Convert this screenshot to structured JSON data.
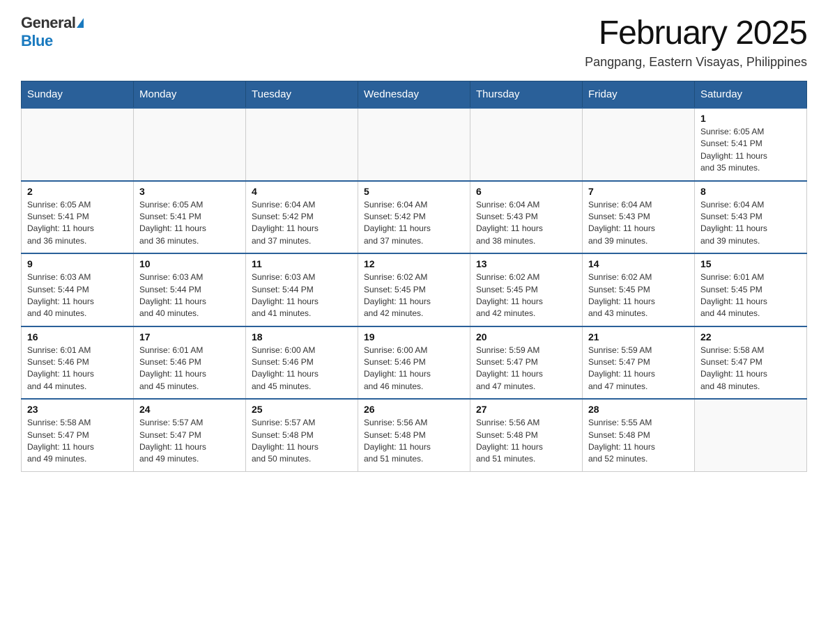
{
  "header": {
    "logo_general": "General",
    "logo_blue": "Blue",
    "month_title": "February 2025",
    "location": "Pangpang, Eastern Visayas, Philippines"
  },
  "weekdays": [
    "Sunday",
    "Monday",
    "Tuesday",
    "Wednesday",
    "Thursday",
    "Friday",
    "Saturday"
  ],
  "weeks": [
    [
      {
        "day": "",
        "info": ""
      },
      {
        "day": "",
        "info": ""
      },
      {
        "day": "",
        "info": ""
      },
      {
        "day": "",
        "info": ""
      },
      {
        "day": "",
        "info": ""
      },
      {
        "day": "",
        "info": ""
      },
      {
        "day": "1",
        "info": "Sunrise: 6:05 AM\nSunset: 5:41 PM\nDaylight: 11 hours\nand 35 minutes."
      }
    ],
    [
      {
        "day": "2",
        "info": "Sunrise: 6:05 AM\nSunset: 5:41 PM\nDaylight: 11 hours\nand 36 minutes."
      },
      {
        "day": "3",
        "info": "Sunrise: 6:05 AM\nSunset: 5:41 PM\nDaylight: 11 hours\nand 36 minutes."
      },
      {
        "day": "4",
        "info": "Sunrise: 6:04 AM\nSunset: 5:42 PM\nDaylight: 11 hours\nand 37 minutes."
      },
      {
        "day": "5",
        "info": "Sunrise: 6:04 AM\nSunset: 5:42 PM\nDaylight: 11 hours\nand 37 minutes."
      },
      {
        "day": "6",
        "info": "Sunrise: 6:04 AM\nSunset: 5:43 PM\nDaylight: 11 hours\nand 38 minutes."
      },
      {
        "day": "7",
        "info": "Sunrise: 6:04 AM\nSunset: 5:43 PM\nDaylight: 11 hours\nand 39 minutes."
      },
      {
        "day": "8",
        "info": "Sunrise: 6:04 AM\nSunset: 5:43 PM\nDaylight: 11 hours\nand 39 minutes."
      }
    ],
    [
      {
        "day": "9",
        "info": "Sunrise: 6:03 AM\nSunset: 5:44 PM\nDaylight: 11 hours\nand 40 minutes."
      },
      {
        "day": "10",
        "info": "Sunrise: 6:03 AM\nSunset: 5:44 PM\nDaylight: 11 hours\nand 40 minutes."
      },
      {
        "day": "11",
        "info": "Sunrise: 6:03 AM\nSunset: 5:44 PM\nDaylight: 11 hours\nand 41 minutes."
      },
      {
        "day": "12",
        "info": "Sunrise: 6:02 AM\nSunset: 5:45 PM\nDaylight: 11 hours\nand 42 minutes."
      },
      {
        "day": "13",
        "info": "Sunrise: 6:02 AM\nSunset: 5:45 PM\nDaylight: 11 hours\nand 42 minutes."
      },
      {
        "day": "14",
        "info": "Sunrise: 6:02 AM\nSunset: 5:45 PM\nDaylight: 11 hours\nand 43 minutes."
      },
      {
        "day": "15",
        "info": "Sunrise: 6:01 AM\nSunset: 5:45 PM\nDaylight: 11 hours\nand 44 minutes."
      }
    ],
    [
      {
        "day": "16",
        "info": "Sunrise: 6:01 AM\nSunset: 5:46 PM\nDaylight: 11 hours\nand 44 minutes."
      },
      {
        "day": "17",
        "info": "Sunrise: 6:01 AM\nSunset: 5:46 PM\nDaylight: 11 hours\nand 45 minutes."
      },
      {
        "day": "18",
        "info": "Sunrise: 6:00 AM\nSunset: 5:46 PM\nDaylight: 11 hours\nand 45 minutes."
      },
      {
        "day": "19",
        "info": "Sunrise: 6:00 AM\nSunset: 5:46 PM\nDaylight: 11 hours\nand 46 minutes."
      },
      {
        "day": "20",
        "info": "Sunrise: 5:59 AM\nSunset: 5:47 PM\nDaylight: 11 hours\nand 47 minutes."
      },
      {
        "day": "21",
        "info": "Sunrise: 5:59 AM\nSunset: 5:47 PM\nDaylight: 11 hours\nand 47 minutes."
      },
      {
        "day": "22",
        "info": "Sunrise: 5:58 AM\nSunset: 5:47 PM\nDaylight: 11 hours\nand 48 minutes."
      }
    ],
    [
      {
        "day": "23",
        "info": "Sunrise: 5:58 AM\nSunset: 5:47 PM\nDaylight: 11 hours\nand 49 minutes."
      },
      {
        "day": "24",
        "info": "Sunrise: 5:57 AM\nSunset: 5:47 PM\nDaylight: 11 hours\nand 49 minutes."
      },
      {
        "day": "25",
        "info": "Sunrise: 5:57 AM\nSunset: 5:48 PM\nDaylight: 11 hours\nand 50 minutes."
      },
      {
        "day": "26",
        "info": "Sunrise: 5:56 AM\nSunset: 5:48 PM\nDaylight: 11 hours\nand 51 minutes."
      },
      {
        "day": "27",
        "info": "Sunrise: 5:56 AM\nSunset: 5:48 PM\nDaylight: 11 hours\nand 51 minutes."
      },
      {
        "day": "28",
        "info": "Sunrise: 5:55 AM\nSunset: 5:48 PM\nDaylight: 11 hours\nand 52 minutes."
      },
      {
        "day": "",
        "info": ""
      }
    ]
  ]
}
